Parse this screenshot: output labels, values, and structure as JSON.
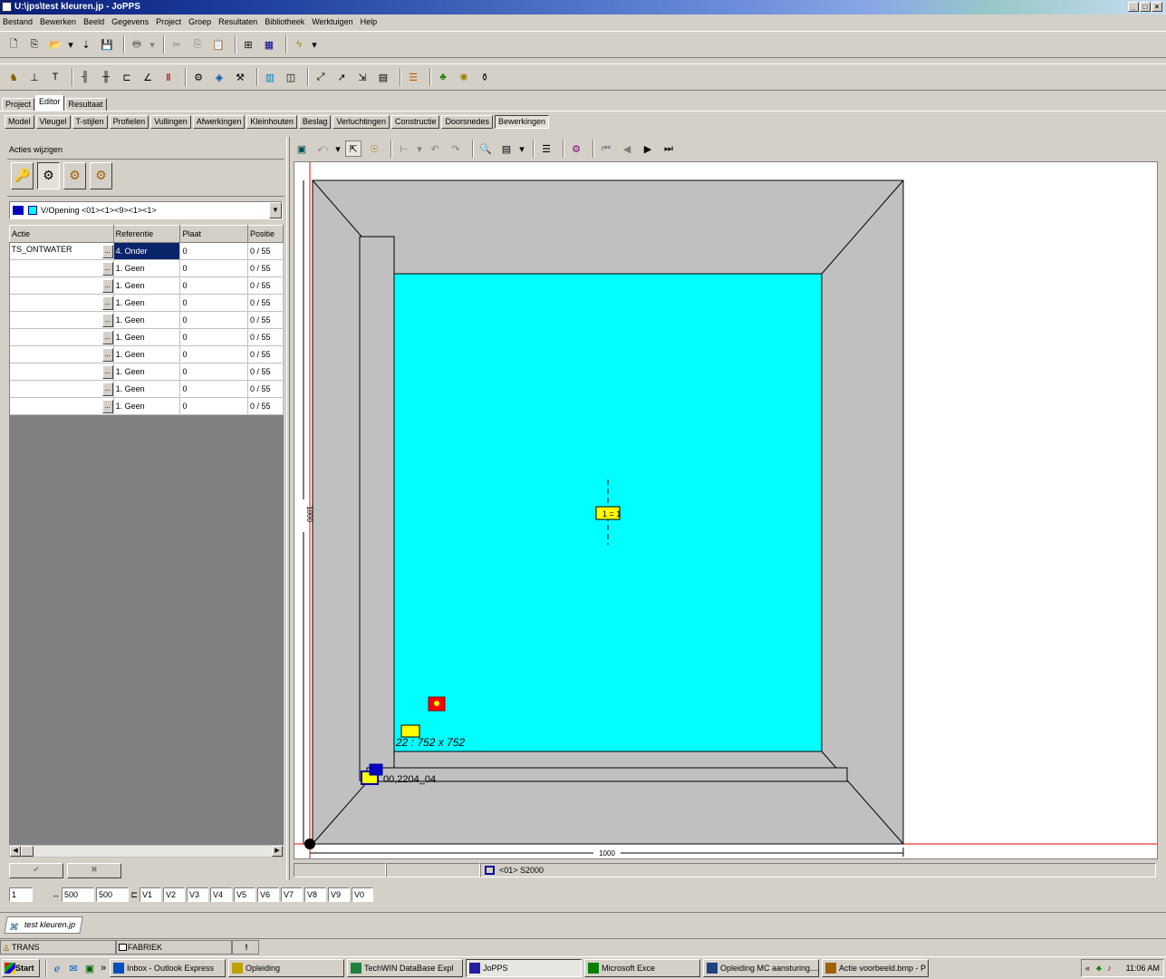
{
  "window": {
    "title": "U:\\jps\\test kleuren.jp - JoPPS"
  },
  "menu": [
    "Bestand",
    "Bewerken",
    "Beeld",
    "Gegevens",
    "Project",
    "Groep",
    "Resultaten",
    "Bibliotheek",
    "Werktuigen",
    "Help"
  ],
  "main_tabs": [
    {
      "label": "Project",
      "active": false
    },
    {
      "label": "Editor",
      "active": true
    },
    {
      "label": "Resultaat",
      "active": false
    }
  ],
  "section_buttons": [
    {
      "label": "Model",
      "pressed": false
    },
    {
      "label": "Vleugel",
      "pressed": false
    },
    {
      "label": "T-stijlen",
      "pressed": false
    },
    {
      "label": "Profielen",
      "pressed": false
    },
    {
      "label": "Vullingen",
      "pressed": false
    },
    {
      "label": "Afwerkingen",
      "pressed": false
    },
    {
      "label": "Kleinhouten",
      "pressed": false
    },
    {
      "label": "Beslag",
      "pressed": false
    },
    {
      "label": "Verluchtingen",
      "pressed": false
    },
    {
      "label": "Constructie",
      "pressed": false
    },
    {
      "label": "Doorsnedes",
      "pressed": false
    },
    {
      "label": "Bewerkingen",
      "pressed": true
    }
  ],
  "left_panel": {
    "title": "Acties wijzigen",
    "dropdown_value": "V/Opening <01><1><9><1><1>",
    "columns": [
      "Actie",
      "Referentie",
      "Plaat",
      "Positie"
    ],
    "rows": [
      {
        "actie": "TS_ONTWATER",
        "referentie": "4. Onder",
        "plaat": "0",
        "positie": "0 / 55",
        "selected": true
      },
      {
        "actie": "",
        "referentie": "1. Geen",
        "plaat": "0",
        "positie": "0 / 55"
      },
      {
        "actie": "",
        "referentie": "1. Geen",
        "plaat": "0",
        "positie": "0 / 55"
      },
      {
        "actie": "",
        "referentie": "1. Geen",
        "plaat": "0",
        "positie": "0 / 55"
      },
      {
        "actie": "",
        "referentie": "1. Geen",
        "plaat": "0",
        "positie": "0 / 55"
      },
      {
        "actie": "",
        "referentie": "1. Geen",
        "plaat": "0",
        "positie": "0 / 55"
      },
      {
        "actie": "",
        "referentie": "1. Geen",
        "plaat": "0",
        "positie": "0 / 55"
      },
      {
        "actie": "",
        "referentie": "1. Geen",
        "plaat": "0",
        "positie": "0 / 55"
      },
      {
        "actie": "",
        "referentie": "1. Geen",
        "plaat": "0",
        "positie": "0 / 55"
      },
      {
        "actie": "",
        "referentie": "1. Geen",
        "plaat": "0",
        "positie": "0 / 55"
      }
    ],
    "ok_label": "✔",
    "cancel_label": "✖"
  },
  "drawing": {
    "label_center": "1 = 1",
    "label_glass": "22 : 752 x 752",
    "label_sill": "00,2204_04",
    "dim_vertical": "1000",
    "dim_horizontal": "1000",
    "fill_color": "#00ffff",
    "frame_color": "#c0c0c0"
  },
  "canvas_status": {
    "field1": "",
    "field2": "",
    "field3": "<01> S2000"
  },
  "coord_bar": {
    "v1": "1",
    "v2": "500",
    "v3": "500",
    "fields": [
      "V1",
      "V2",
      "V3",
      "V4",
      "V5",
      "V6",
      "V7",
      "V8",
      "V9",
      "V0"
    ]
  },
  "doc_tab": "test kleuren.jp",
  "info_bar": {
    "left": "TRANS",
    "mid": "FABRIEK",
    "icon": "!"
  },
  "taskbar": {
    "start": "Start",
    "tasks": [
      {
        "label": "Inbox - Outlook Express",
        "pressed": false
      },
      {
        "label": "Opleiding",
        "pressed": false
      },
      {
        "label": "TechWIN DataBase Expl",
        "pressed": false
      },
      {
        "label": "JoPPS",
        "pressed": true
      },
      {
        "label": "Microsoft Exce",
        "pressed": false
      },
      {
        "label": "Opleiding MC aansturing....",
        "pressed": false
      },
      {
        "label": "Actie voorbeeld.bmp - P",
        "pressed": false
      }
    ],
    "clock": "11:06 AM"
  }
}
